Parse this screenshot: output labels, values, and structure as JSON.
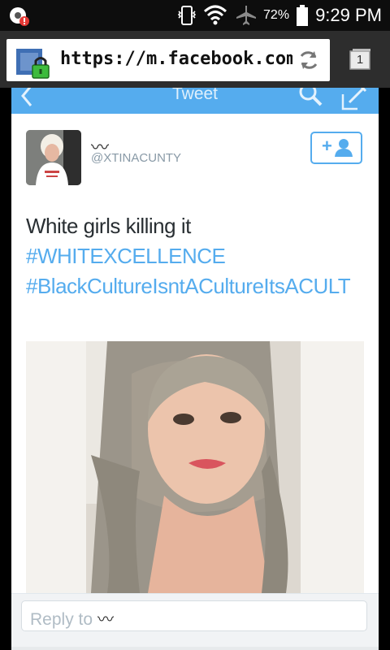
{
  "status_bar": {
    "left_icon": "chrome-notification-icon",
    "signal_icon": "vibrate-icon",
    "wifi_icon": "wifi-icon",
    "airplane_icon": "airplane-icon",
    "battery_percent": "72%",
    "battery_icon": "battery-icon",
    "time": "9:29 PM"
  },
  "browser": {
    "url": "https://m.facebook.com",
    "lock_icon": "secure-lock-icon",
    "reload_icon": "reload-icon",
    "tab_count": "1"
  },
  "twitter": {
    "nav_title": "Tweet",
    "back_icon": "back-arrow-icon",
    "search_icon": "search-icon",
    "compose_icon": "compose-icon",
    "display_name": "〰",
    "handle": "@XTINACUNTY",
    "follow_icon": "add-user-icon",
    "follow_label": "+",
    "tweet_text": "White girls killing it",
    "hashtags": [
      "#WHITEXCELLENCE",
      "#BlackCultureIsntACultureItsACULT"
    ],
    "reply_placeholder": "Reply to",
    "reply_name": "〰"
  },
  "colors": {
    "twitter_blue": "#55acee",
    "status_bar_bg": "#0d0d0d",
    "url_bar_bg": "#2d2d2d"
  }
}
